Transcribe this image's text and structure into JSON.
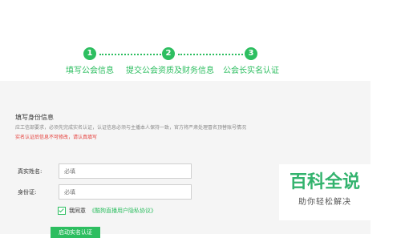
{
  "steps": [
    {
      "number": "1",
      "label": "填写公会信息"
    },
    {
      "number": "2",
      "label": "提交公会资质及财务信息"
    },
    {
      "number": "3",
      "label": "公会长实名认证"
    }
  ],
  "section": {
    "title": "填写身份信息",
    "description": "应工信部要求，必须先完成实名认证，认证信息必须与主播本人保持一致，官方将严肃处理冒名顶替账号情况",
    "warning": "实名认证后信息不可修改，请认真填写"
  },
  "form": {
    "name_label": "真实姓名:",
    "name_placeholder": "必填",
    "id_label": "身份证:",
    "id_placeholder": "必填",
    "agree_prefix": "我同意",
    "agree_link": "《酷狗直播用户隐私协议》",
    "submit_label": "启动实名认证"
  },
  "watermark": {
    "main": "百科全说",
    "sub": "助你轻松解决"
  },
  "colors": {
    "accent": "#2dbe60",
    "warning": "#e53935"
  }
}
